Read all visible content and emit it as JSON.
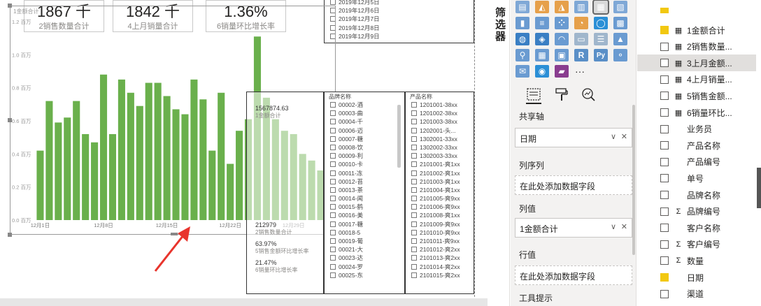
{
  "kpis": [
    {
      "value": "1867 千",
      "label": "2销售数量合计"
    },
    {
      "value": "1842 千",
      "label": "4上月销量合计"
    },
    {
      "value": "1.36%",
      "label": "6销量环比增长率"
    }
  ],
  "chart_data": {
    "type": "bar",
    "title": "1金额合计",
    "ytick_labels": [
      "0.0 百万",
      "0.2 百万",
      "0.4 百万",
      "0.6 百万",
      "0.8 百万",
      "1.0 百万",
      "1.2 百万"
    ],
    "xtick_labels": [
      "12月1日",
      "12月8日",
      "12月15日",
      "12月22日",
      "12月29日"
    ],
    "ylim": [
      0,
      1.2
    ],
    "values": [
      0.42,
      0.72,
      0.59,
      0.62,
      0.72,
      0.52,
      0.47,
      0.88,
      0.52,
      0.85,
      0.77,
      0.69,
      0.83,
      0.83,
      0.75,
      0.67,
      0.64,
      0.85,
      0.73,
      0.42,
      0.77,
      0.34,
      0.54,
      0.61,
      1.11,
      0.74,
      0.61,
      0.54,
      0.52,
      0.4,
      0.36,
      0.3
    ]
  },
  "date_slicer": {
    "items": [
      "2019年12月5日",
      "2019年12月6日",
      "2019年12月7日",
      "2019年12月8日",
      "2019年12月9日"
    ]
  },
  "cards_col": [
    {
      "value": "1567874.63",
      "label": "1金额合计"
    },
    {
      "value": "212979",
      "label": "2销售数量合计"
    },
    {
      "value": "63.97%",
      "label": "5销售金额环比增长率"
    },
    {
      "value": "21.47%",
      "label": "6销量环比增长率"
    }
  ],
  "brand_slicer": {
    "title": "品牌名称",
    "items": [
      "00002-酒",
      "00003-曲",
      "00004-千",
      "00006-迈",
      "00007-糖",
      "00008-饮",
      "00009-利",
      "00010-卡",
      "00011-冻",
      "00012-苔",
      "00013-茶",
      "00014-闻",
      "00015-鹤",
      "00016-美",
      "00017-糖",
      "00018-5",
      "00019-葡",
      "00021-大",
      "00023-达",
      "00024-罗",
      "00025-东"
    ]
  },
  "product_slicer": {
    "title": "产品名称",
    "items": [
      "1201001-38xx",
      "1201002-38xx",
      "1201003-38xx",
      "1202001-头...",
      "1302001-33xx",
      "1302002-33xx",
      "1302003-33xx",
      "2101001-爽1xx",
      "2101002-爽1xx",
      "2101003-爽1xx",
      "2101004-爽1xx",
      "2101005-爽9xx",
      "2101006-爽9xx",
      "2101008-爽1xx",
      "2101009-爽9xx",
      "2101010-爽9xx",
      "2101011-爽9xx",
      "2101012-爽2xx",
      "2101013-爽2xx",
      "2101014-爽2xx",
      "2101015-爽2xx"
    ]
  },
  "filter_pane": {
    "label": "筛选器"
  },
  "viz_pane": {
    "shared_axis": {
      "label": "共享轴",
      "field": "日期"
    },
    "column_series": {
      "label": "列序列",
      "placeholder": "在此处添加数据字段"
    },
    "column_values": {
      "label": "列值",
      "field": "1金额合计"
    },
    "row_values": {
      "label": "行值",
      "placeholder": "在此处添加数据字段"
    },
    "tooltips": {
      "label": "工具提示"
    },
    "more_label": "···"
  },
  "fields": [
    {
      "name": "1金额合计",
      "checked": true,
      "type": "calc"
    },
    {
      "name": "2销售数量...",
      "checked": false,
      "type": "calc"
    },
    {
      "name": "3上月金额...",
      "checked": false,
      "type": "calc"
    },
    {
      "name": "4上月销量...",
      "checked": false,
      "type": "calc"
    },
    {
      "name": "5销售金额...",
      "checked": false,
      "type": "calc"
    },
    {
      "name": "6销量环比...",
      "checked": false,
      "type": "calc"
    },
    {
      "name": "业务员",
      "checked": false,
      "type": "text"
    },
    {
      "name": "产品名称",
      "checked": false,
      "type": "text"
    },
    {
      "name": "产品编号",
      "checked": false,
      "type": "text"
    },
    {
      "name": "单号",
      "checked": false,
      "type": "text"
    },
    {
      "name": "品牌名称",
      "checked": false,
      "type": "text"
    },
    {
      "name": "品牌编号",
      "checked": false,
      "type": "sum"
    },
    {
      "name": "客户名称",
      "checked": false,
      "type": "text"
    },
    {
      "name": "客户编号",
      "checked": false,
      "type": "sum"
    },
    {
      "name": "数量",
      "checked": false,
      "type": "sum"
    },
    {
      "name": "日期",
      "checked": true,
      "type": "text"
    },
    {
      "name": "渠道",
      "checked": false,
      "type": "text"
    }
  ],
  "colors": {
    "bar": "#6ab04c",
    "accent": "#f2c811",
    "arrow": "#e8342c"
  }
}
